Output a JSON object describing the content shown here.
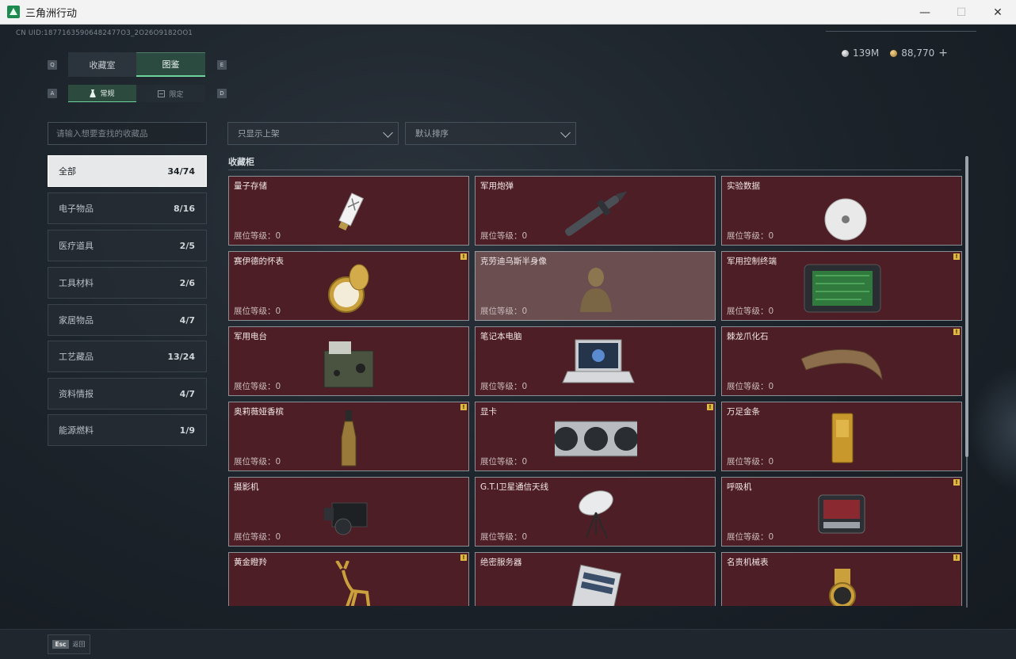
{
  "window": {
    "title": "三角洲行动",
    "minimize": "—",
    "maximize": "☐",
    "close": "✕"
  },
  "header": {
    "uid": "CN UID:18771635906482477O3_2O26O9182OO1",
    "currency": [
      {
        "icon": "silver-coin-icon",
        "value": "139M"
      },
      {
        "icon": "gold-coin-icon",
        "value": "88,770"
      }
    ],
    "add_label": "+"
  },
  "tabs": {
    "key_left": "Q",
    "key_right": "E",
    "items": [
      {
        "label": "收藏室",
        "active": false
      },
      {
        "label": "图鉴",
        "active": true
      }
    ]
  },
  "subtabs": {
    "key_left": "A",
    "key_right": "D",
    "items": [
      {
        "label": "常规",
        "icon": "flask-icon",
        "active": true
      },
      {
        "label": "限定",
        "icon": "limited-icon",
        "active": false
      }
    ]
  },
  "search": {
    "placeholder": "请输入想要查找的收藏品"
  },
  "filters": {
    "shelf": "只显示上架",
    "sort": "默认排序"
  },
  "categories": [
    {
      "label": "全部",
      "count": "34/74",
      "active": true
    },
    {
      "label": "电子物品",
      "count": "8/16"
    },
    {
      "label": "医疗道具",
      "count": "2/5"
    },
    {
      "label": "工具材料",
      "count": "2/6"
    },
    {
      "label": "家居物品",
      "count": "4/7"
    },
    {
      "label": "工艺藏品",
      "count": "13/24"
    },
    {
      "label": "资料情报",
      "count": "4/7"
    },
    {
      "label": "能源燃料",
      "count": "1/9"
    }
  ],
  "section": {
    "title": "收藏柜"
  },
  "level_label": "展位等级：0",
  "badge_label": "!",
  "items": [
    {
      "name": "量子存储",
      "art": "usb-drive-icon",
      "badge": false
    },
    {
      "name": "军用炮弹",
      "art": "artillery-shell-icon",
      "badge": false
    },
    {
      "name": "实验数据",
      "art": "disc-icon",
      "badge": false
    },
    {
      "name": "赛伊德的怀表",
      "art": "pocket-watch-icon",
      "badge": true
    },
    {
      "name": "克劳迪乌斯半身像",
      "art": "bust-statue-icon",
      "badge": false,
      "light": true
    },
    {
      "name": "军用控制终端",
      "art": "control-terminal-icon",
      "badge": true
    },
    {
      "name": "军用电台",
      "art": "military-radio-icon",
      "badge": false
    },
    {
      "name": "笔记本电脑",
      "art": "laptop-icon",
      "badge": false
    },
    {
      "name": "棘龙爪化石",
      "art": "claw-fossil-icon",
      "badge": true
    },
    {
      "name": "奥莉薇娅香槟",
      "art": "champagne-bottle-icon",
      "badge": true
    },
    {
      "name": "显卡",
      "art": "graphics-card-icon",
      "badge": true
    },
    {
      "name": "万足金条",
      "art": "gold-bar-icon",
      "badge": false
    },
    {
      "name": "摄影机",
      "art": "video-camera-icon",
      "badge": false
    },
    {
      "name": "G.T.I卫星通信天线",
      "art": "satellite-dish-icon",
      "badge": false
    },
    {
      "name": "呼吸机",
      "art": "ventilator-icon",
      "badge": true
    },
    {
      "name": "黄金瞪羚",
      "art": "golden-gazelle-icon",
      "badge": true
    },
    {
      "name": "绝密服务器",
      "art": "server-icon",
      "badge": false
    },
    {
      "name": "名贵机械表",
      "art": "luxury-watch-icon",
      "badge": true
    }
  ],
  "footer": {
    "esc_key": "Esc",
    "back_label": "返回"
  }
}
